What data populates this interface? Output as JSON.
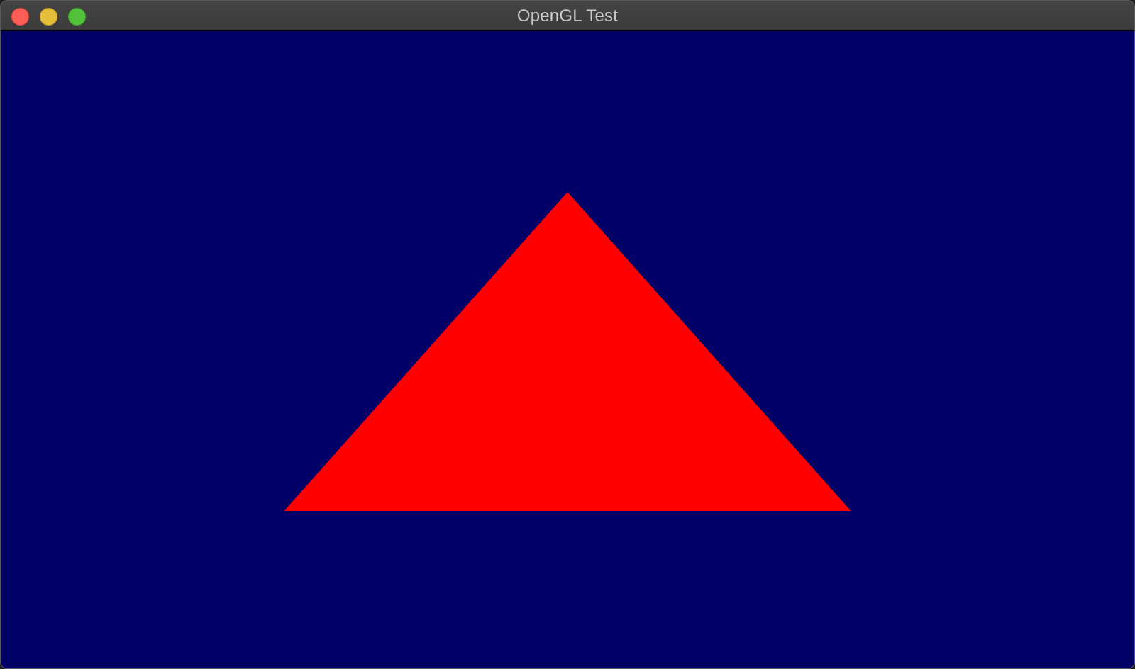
{
  "window": {
    "title": "OpenGL Test",
    "buttons": {
      "close": {
        "color": "#ff5f57",
        "icon": "close-icon"
      },
      "minimize": {
        "color": "#e6bd39",
        "icon": "minimize-icon"
      },
      "zoom": {
        "color": "#52c23a",
        "icon": "zoom-icon"
      }
    }
  },
  "scene": {
    "clear_color": "#000066",
    "triangle": {
      "color": "#ff0000"
    }
  }
}
